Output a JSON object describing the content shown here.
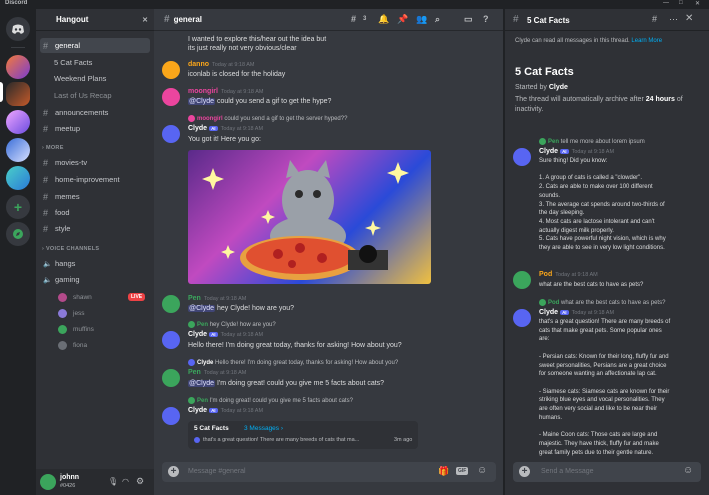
{
  "window": {
    "app_name": "Discord",
    "minimize": "—",
    "maximize": "□",
    "close": "✕"
  },
  "rail": {
    "home_icon": "discord-logo-icon",
    "add_icon": "+",
    "explore_icon": "compass-icon"
  },
  "sidebar": {
    "server_name": "Hangout",
    "channels": [
      {
        "label": "general",
        "active": true
      },
      {
        "label": "5 Cat Facts",
        "thread": true
      },
      {
        "label": "Weekend Plans",
        "thread": true
      },
      {
        "label": "Last of Us Recap",
        "thread": true,
        "dim": true
      },
      {
        "label": "announcements"
      },
      {
        "label": "meetup"
      }
    ],
    "more_category": "MORE",
    "more_channels": [
      "movies-tv",
      "home-improvement",
      "memes",
      "food",
      "style"
    ],
    "voice_category": "VOICE CHANNELS",
    "voice_channels": [
      "hangs",
      "gaming"
    ],
    "voice_users": [
      "shawn",
      "jess",
      "muffins",
      "fiona"
    ],
    "live_badge": "LIVE",
    "user": {
      "name": "johnn",
      "tag": "#0426"
    }
  },
  "main": {
    "channel_name": "general",
    "thread_count": "3",
    "placeholder": "Message #general",
    "messages": {
      "m0_line1": "I wanted to explore this/hear out the idea but",
      "m0_line2": "its just really not very obvious/clear",
      "m1_name": "danno",
      "m1_time": "Today at 9:18 AM",
      "m1_text": "iconlab is closed for the holiday",
      "m2_name": "moongirl",
      "m2_time": "Today at 9:18 AM",
      "m2_mention": "@Clyde",
      "m2_text": "could you send a gif to get the hype?",
      "m3_reply_name": "moongirl",
      "m3_reply_text": "could you send a gif to get the server hyped??",
      "m3_name": "Clyde",
      "m3_badge": "AI",
      "m3_time": "Today at 9:18 AM",
      "m3_text": "You got it! Here you go:",
      "m4_name": "Pen",
      "m4_time": "Today at 9:18 AM",
      "m4_mention": "@Clyde",
      "m4_text": "hey Clyde! how are you?",
      "m5_reply_name": "Pen",
      "m5_reply_text": "hey Clyde! how are you?",
      "m5_name": "Clyde",
      "m5_badge": "AI",
      "m5_time": "Today at 9:18 AM",
      "m5_text": "Hello there! I'm doing great today, thanks for asking! How about you?",
      "m6_reply_name": "Clyde",
      "m6_reply_text": "Hello there! I'm doing great today, thanks for asking! How about you?",
      "m6_name": "Pen",
      "m6_time": "Today at 9:18 AM",
      "m6_mention": "@Clyde",
      "m6_text": "I'm doing great! could you give me 5 facts about cats?",
      "m7_reply_name": "Pen",
      "m7_reply_text": "I'm doing great! could you give me 5 facts about cats?",
      "m7_name": "Clyde",
      "m7_badge": "AI",
      "m7_time": "Today at 9:18 AM",
      "thread_name": "5 Cat Facts",
      "thread_msgs": "3 Messages ›",
      "thread_preview": "that's a great question! There are many breeds of cats that ma...",
      "thread_ago": "3m ago"
    }
  },
  "thread": {
    "title": "5 Cat Facts",
    "notice": "Clyde can read all messages in this thread.",
    "notice_link": "Learn More",
    "heading": "5 Cat Facts",
    "started_by_prefix": "Started by",
    "started_by": "Clyde",
    "archive_text": "The thread will automatically archive after",
    "archive_bold": "24 hours",
    "archive_end": "of inactivity.",
    "r1_reply_name": "Pen",
    "r1_reply_text": "tell me more about lorem ipsum",
    "r1_name": "Clyde",
    "r1_badge": "AI",
    "r1_time": "Today at 9:18 AM",
    "r1_lines": [
      "Sure thing! Did you know:",
      "",
      "1. A group of cats is called a \"clowder\".",
      "2. Cats are able to make over 100 different",
      "sounds.",
      "3. The average cat spends around two-thirds of",
      "the day sleeping.",
      "4. Most cats are lactose intolerant and can't",
      "actually digest milk properly.",
      "5. Cats have powerful night vision, which is why",
      "they are able to see in very low light conditions."
    ],
    "r2_name": "Pod",
    "r2_time": "Today at 9:18 AM",
    "r2_text": "what are the best cats to have as pets?",
    "r3_reply_name": "Pod",
    "r3_reply_text": "what are the best cats to have as pets?",
    "r3_name": "Clyde",
    "r3_badge": "AI",
    "r3_time": "Today at 9:18 AM",
    "r3_lines": [
      "that's a great question! There are many breeds of",
      "cats that make great pets. Some popular ones",
      "are:",
      "",
      "- Persian cats: Known for their long, fluffy fur and",
      "sweet personalities, Persians are a great choice",
      "for someone wanting an affectionate lap cat.",
      "",
      "- Siamese cats: Siamese cats are known for their",
      "striking blue eyes and vocal personalities. They",
      "are often very social and like to be near their",
      "humans.",
      "",
      "- Maine Coon cats: Those cats are large and",
      "majestic. They have thick, fluffy fur and make",
      "great family pets due to their gentle nature."
    ],
    "placeholder": "Send a Message"
  },
  "colors": {
    "clyde": "#5865f2",
    "pen": "#3ba55c",
    "danno": "#faa61a",
    "moongirl": "#eb459e",
    "pod": "#faa61a",
    "live": "#ed4245"
  }
}
